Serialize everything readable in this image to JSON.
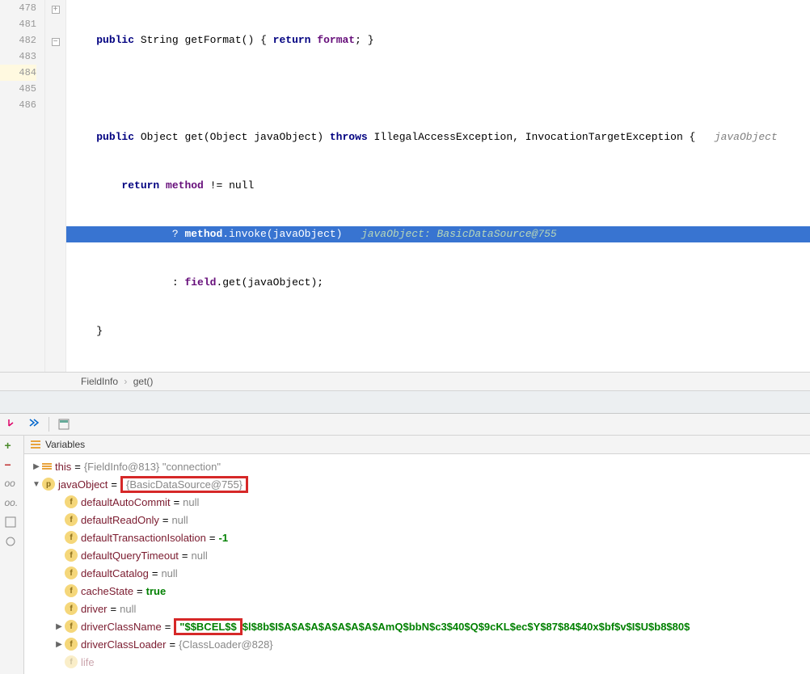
{
  "gutter": [
    "478",
    "481",
    "482",
    "483",
    "484",
    "485",
    "486"
  ],
  "code": {
    "l478_pre": "    ",
    "l478_public": "public",
    "l478_mid1": " String getFormat() ",
    "l478_lb": "{",
    "l478_return": " return ",
    "l478_format": "format",
    "l478_end": "; }",
    "l481": "",
    "l482_pre": "    ",
    "l482_public": "public",
    "l482_mid": " Object get(Object javaObject) ",
    "l482_throws": "throws",
    "l482_exc": " IllegalAccessException, InvocationTargetException {   ",
    "l482_hint": "javaObject",
    "l483_pre": "        ",
    "l483_return": "return",
    "l483_sp": " ",
    "l483_method": "method",
    "l483_rest": " != null",
    "l484_pre": "                ? ",
    "l484_method": "method",
    "l484_mid": ".invoke(javaObject)   ",
    "l484_hint": "javaObject: BasicDataSource@755",
    "l485_pre": "                : ",
    "l485_field": "field",
    "l485_rest": ".get(javaObject);",
    "l486": "    }"
  },
  "breadcrumb": {
    "a": "FieldInfo",
    "b": "get()"
  },
  "varsTitle": "Variables",
  "tree": {
    "this_name": "this",
    "this_val": "{FieldInfo@813} \"connection\"",
    "javaObject_name": "javaObject",
    "javaObject_val": "{BasicDataSource@755}",
    "f1_name": "defaultAutoCommit",
    "f1_val": "null",
    "f2_name": "defaultReadOnly",
    "f2_val": "null",
    "f3_name": "defaultTransactionIsolation",
    "f3_val": "-1",
    "f4_name": "defaultQueryTimeout",
    "f4_val": "null",
    "f5_name": "defaultCatalog",
    "f5_val": "null",
    "f6_name": "cacheState",
    "f6_val": "true",
    "f7_name": "driver",
    "f7_val": "null",
    "f8_name": "driverClassName",
    "f8_val_a": "\"$$BCEL$$",
    "f8_val_b": "$l$8b$I$A$A$A$A$A$A$A$AmQ$bbN$c3$40$Q$9cKL$ec$Y$87$84$40x$bf$v$I$U$b8$80$",
    "f9_name": "driverClassLoader",
    "f9_val": "{ClassLoader@828}",
    "f10_name": "life"
  }
}
